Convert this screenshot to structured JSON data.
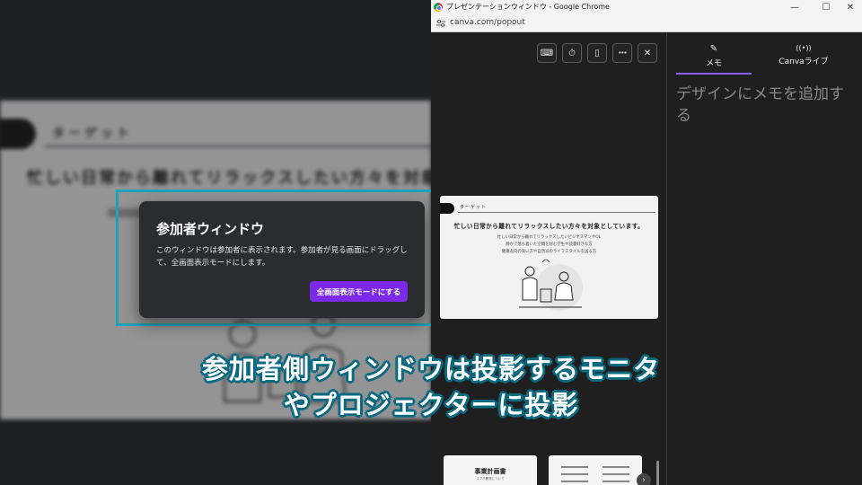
{
  "audience_slide": {
    "tag": "ターゲット",
    "headline": "忙しい日常から離れてリラックスしたい方々を対象と"
  },
  "participant_dialog": {
    "title": "参加者ウィンドウ",
    "body": "このウィンドウは参加者に表示されます。参加者が見る画面にドラッグして、全画面表示モードにします。",
    "button_label": "全画面表示モードにする"
  },
  "chrome": {
    "window_title": "プレゼンテーションウィンドウ - Google Chrome",
    "url": "canva.com/popout",
    "controls": {
      "minimize": "—",
      "maximize": "☐",
      "close": "✕"
    }
  },
  "toolbar": {
    "keyboard_icon": "⌨",
    "timer_icon": "⏱",
    "remote_icon": "▯",
    "more_icon": "•••",
    "close_icon": "✕"
  },
  "current_slide": {
    "tag": "ターゲット",
    "headline": "忙しい日常から離れてリラックスしたい方々を対象としています。",
    "sub_lines": [
      "忙しい日常から離れてリラックスしたいビジネスマンやOL",
      "静かで落ち着いた空間を好む学生や読書好きな方",
      "健康志向の高い方や自然派のライフスタイルを送る方"
    ]
  },
  "next_slides": [
    {
      "title": "事業計画書",
      "subtitle": "スマホ開発について"
    },
    {
      "title": ""
    }
  ],
  "notes_panel": {
    "tabs": [
      {
        "icon": "✎",
        "label": "メモ"
      },
      {
        "icon": "((•))",
        "label": "Canvaライブ"
      }
    ],
    "placeholder": "デザインにメモを追加する"
  },
  "caption": {
    "line1": "参加者側ウィンドウは投影するモニタ",
    "line2": "やプロジェクターに投影"
  },
  "colors": {
    "accent_purple": "#7d2ae8",
    "highlight_teal": "#1aa3b8",
    "caption_outline": "#0b6a80"
  }
}
